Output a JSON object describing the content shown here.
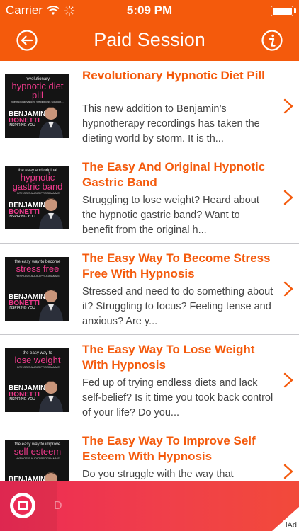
{
  "status_bar": {
    "carrier": "Carrier",
    "time": "5:09 PM"
  },
  "nav": {
    "title": "Paid Session",
    "back_icon": "back-arrow-circle-icon",
    "info_icon": "info-circle-icon"
  },
  "colors": {
    "accent": "#f45a0c",
    "title_text": "#f45a0c",
    "ad_bar": "#ec2a55",
    "thumb_pink": "#ef3a8c"
  },
  "sessions": [
    {
      "title": "Revolutionary Hypnotic Diet Pill",
      "description": "This new addition to Benjamin’s hypnotherapy recordings has taken the dieting world by storm. It is th...",
      "cover": {
        "top": "revolutionary",
        "main": "hypnotic diet pill",
        "sub": "the most advanced weight-loss solution..."
      }
    },
    {
      "title": "The Easy And Original Hypnotic Gastric Band",
      "description": "Struggling to lose weight? Heard about the hypnotic gastric band? Want to benefit from the original h...",
      "cover": {
        "top": "the easy and original",
        "main": "hypnotic gastric band",
        "sub": "HYPNOSIS AUDIO PROGRAMME"
      }
    },
    {
      "title": "The Easy Way To Become Stress Free With Hypnosis",
      "description": "Stressed and need to do something about it? Struggling to focus? Feeling tense and anxious?  Are y...",
      "cover": {
        "top": "the easy way to become",
        "main": "stress free",
        "sub": "HYPNOSIS AUDIO PROGRAMME"
      }
    },
    {
      "title": "The Easy Way To Lose Weight With Hypnosis",
      "description": "Fed up of trying endless diets and lack self-belief? Is it time you took back control of your life? Do you...",
      "cover": {
        "top": "the easy way to",
        "main": "lose weight",
        "sub": "HYPNOSIS AUDIO PROGRAMME"
      }
    },
    {
      "title": "The Easy Way To Improve Self Esteem With Hypnosis",
      "description": "Do you struggle with the way that",
      "cover": {
        "top": "the easy way to improve",
        "main": "self esteem",
        "sub": "HYPNOSIS AUDIO PROGRAMME"
      }
    }
  ],
  "cover_brand": {
    "line1": "BENJAMIN",
    "line2": "BONETTI",
    "line3": "INSPIRING YOU"
  },
  "ad": {
    "letter": "D",
    "label": "iAd"
  }
}
